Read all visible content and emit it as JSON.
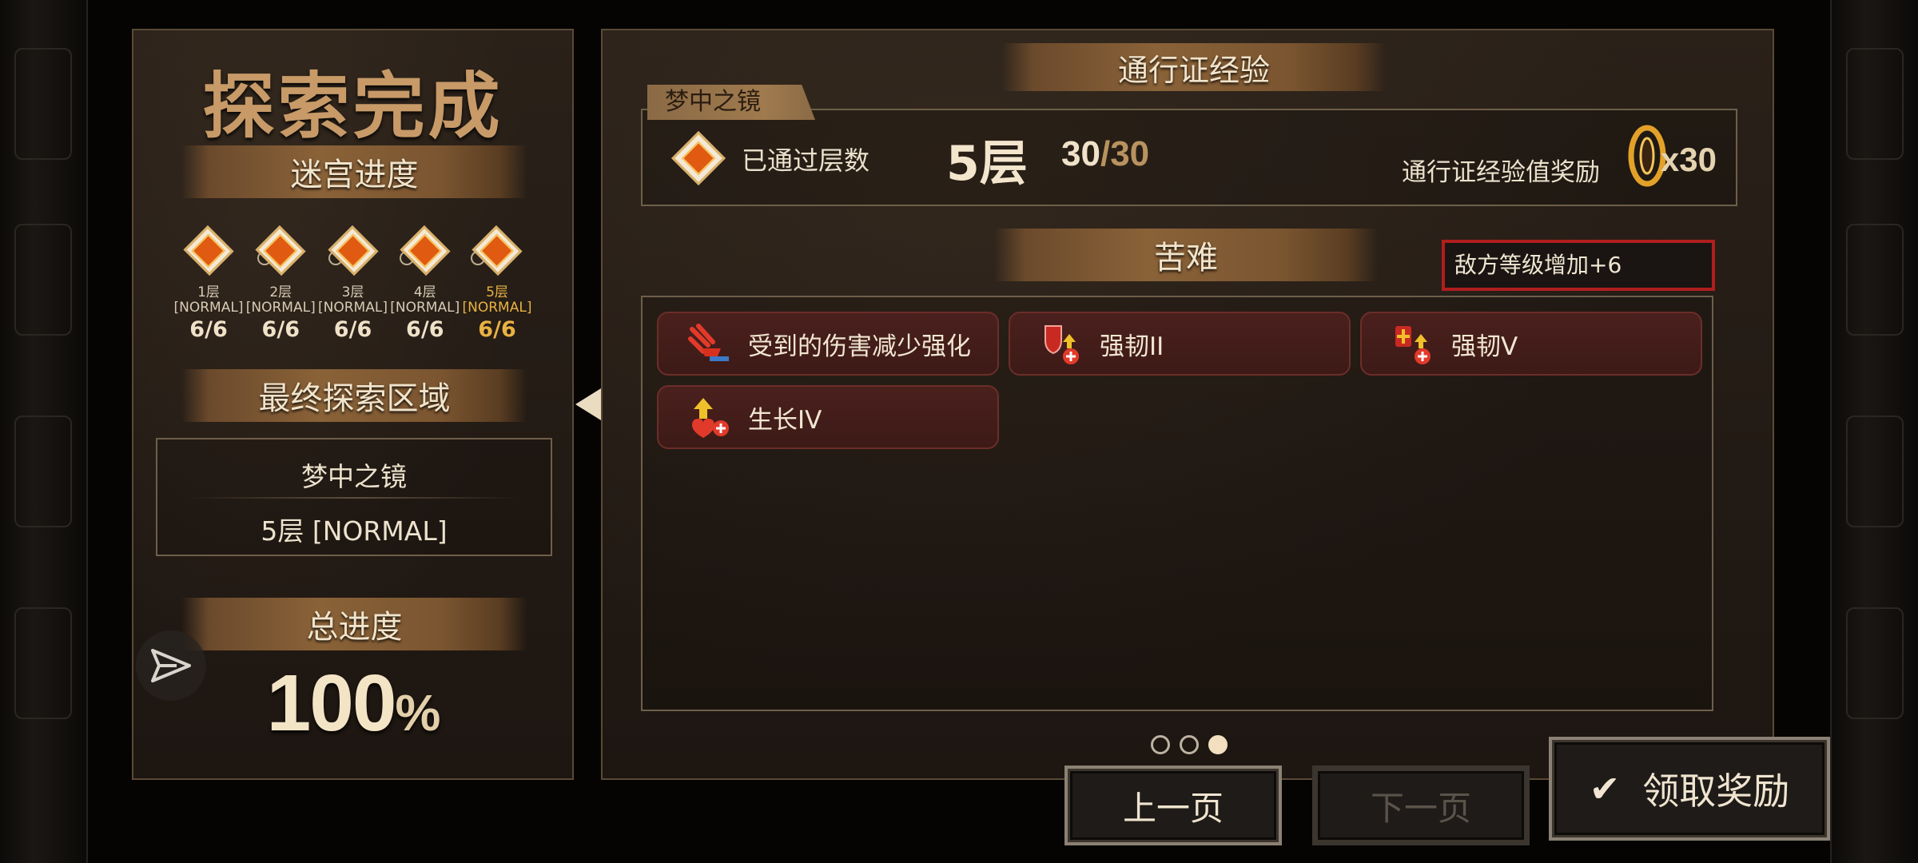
{
  "left": {
    "title": "探索完成",
    "labyrinth_progress_label": "迷宫进度",
    "floors": [
      {
        "name": "1层",
        "mode": "[NORMAL]",
        "count": "6",
        "total": "6"
      },
      {
        "name": "2层",
        "mode": "[NORMAL]",
        "count": "6",
        "total": "6"
      },
      {
        "name": "3层",
        "mode": "[NORMAL]",
        "count": "6",
        "total": "6"
      },
      {
        "name": "4层",
        "mode": "[NORMAL]",
        "count": "6",
        "total": "6"
      },
      {
        "name": "5层",
        "mode": "[NORMAL]",
        "count": "6",
        "total": "6"
      }
    ],
    "final_region_label": "最终探索区域",
    "final_region_name": "梦中之镜",
    "final_region_floor": "5层 [NORMAL]",
    "total_progress_label": "总进度",
    "total_progress_value": "100",
    "total_progress_unit": "%"
  },
  "right": {
    "pass_exp_label": "通行证经验",
    "area_tab": "梦中之镜",
    "floors_passed_label": "已通过层数",
    "floors_passed_value": "5层",
    "floor_progress_current": "30",
    "floor_progress_sep": "/",
    "floor_progress_max": "30",
    "exp_reward_label": "通行证经验值奖励",
    "exp_reward_count": "x30",
    "hardship_label": "苦难",
    "enemy_level_tag": "敌方等级增加+6",
    "buffs": [
      {
        "label": "受到的伤害减少强化",
        "icon": "damage-reduction-icon"
      },
      {
        "label": "强韧II",
        "icon": "toughness-icon"
      },
      {
        "label": "强韧V",
        "icon": "toughness-plus-icon"
      },
      {
        "label": "生长IV",
        "icon": "growth-icon"
      }
    ],
    "page_indicator": {
      "total": 3,
      "current": 3
    }
  },
  "buttons": {
    "prev": "上一页",
    "next": "下一页",
    "claim": "领取奖励"
  },
  "colors": {
    "accent_gold": "#e9b243",
    "panel_border": "#5a4a36",
    "warning_red": "#b01e1e"
  }
}
